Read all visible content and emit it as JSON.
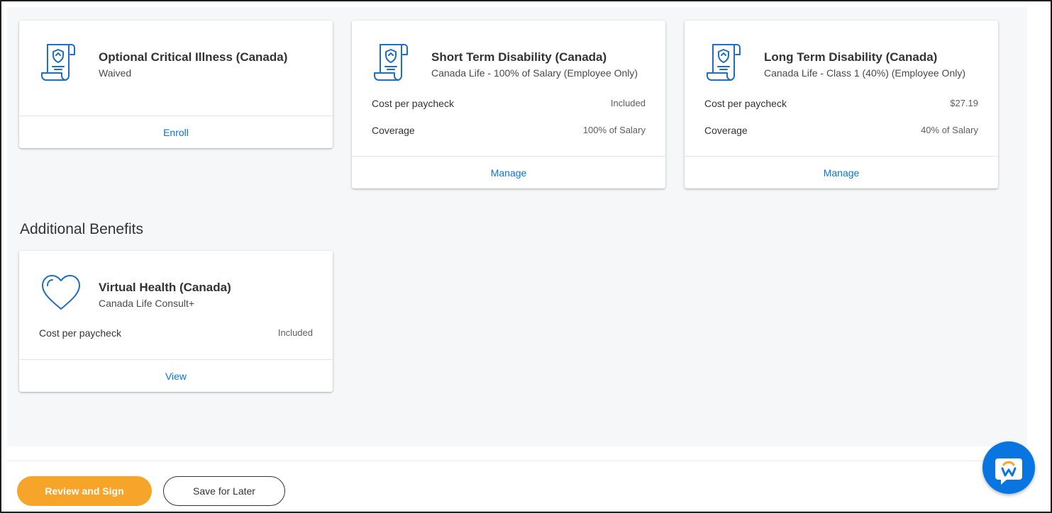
{
  "cards": [
    {
      "title": "Optional Critical Illness (Canada)",
      "subtitle": "Waived",
      "icon": "policy-scroll-icon",
      "action": "Enroll"
    },
    {
      "title": "Short Term Disability (Canada)",
      "subtitle": "Canada Life - 100% of Salary (Employee Only)",
      "icon": "policy-scroll-icon",
      "rows": [
        {
          "label": "Cost per paycheck",
          "value": "Included"
        },
        {
          "label": "Coverage",
          "value": "100% of Salary"
        }
      ],
      "action": "Manage"
    },
    {
      "title": "Long Term Disability (Canada)",
      "subtitle": "Canada Life - Class 1 (40%) (Employee Only)",
      "icon": "policy-scroll-icon",
      "rows": [
        {
          "label": "Cost per paycheck",
          "value": "$27.19"
        },
        {
          "label": "Coverage",
          "value": "40% of Salary"
        }
      ],
      "action": "Manage"
    }
  ],
  "additional": {
    "section_title": "Additional Benefits",
    "cards": [
      {
        "title": "Virtual Health (Canada)",
        "subtitle": "Canada Life Consult+",
        "icon": "heart-icon",
        "rows": [
          {
            "label": "Cost per paycheck",
            "value": "Included"
          }
        ],
        "action": "View"
      }
    ]
  },
  "footer": {
    "primary_label": "Review and Sign",
    "secondary_label": "Save for Later"
  },
  "assistant": {
    "icon": "workday-assistant-icon"
  },
  "colors": {
    "accent_blue": "#0875e1",
    "primary_orange": "#f7a42a",
    "icon_blue": "#1f6fc0"
  }
}
